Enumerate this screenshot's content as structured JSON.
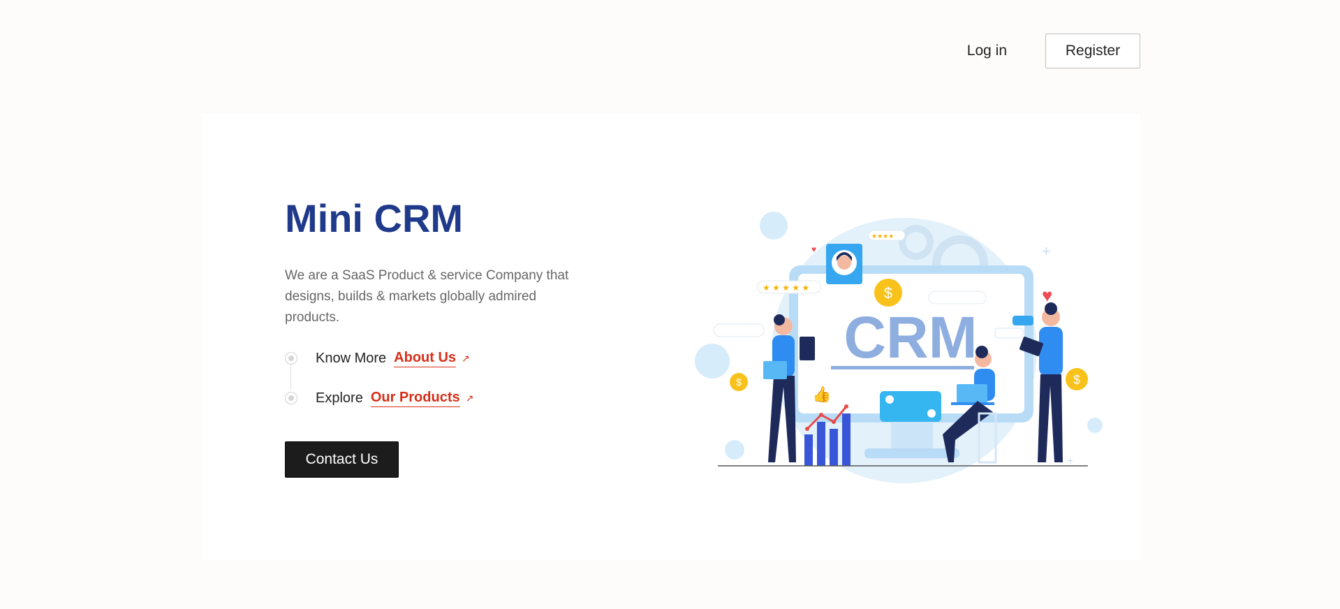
{
  "nav": {
    "login": "Log in",
    "register": "Register"
  },
  "hero": {
    "title": "Mini CRM",
    "description": "We are a SaaS Product & service Company that designs, builds & markets globally admired products.",
    "links": [
      {
        "prefix": "Know More",
        "label": "About Us",
        "icon": "external-arrow-icon"
      },
      {
        "prefix": "Explore",
        "label": "Our Products",
        "icon": "external-arrow-icon"
      }
    ],
    "cta": "Contact Us"
  },
  "illustration": {
    "text": "CRM"
  },
  "colors": {
    "accent": "#1f3a8a",
    "link": "#d62f18",
    "button": "#1c1c1c",
    "illus_blue": "#2f8cf0"
  }
}
